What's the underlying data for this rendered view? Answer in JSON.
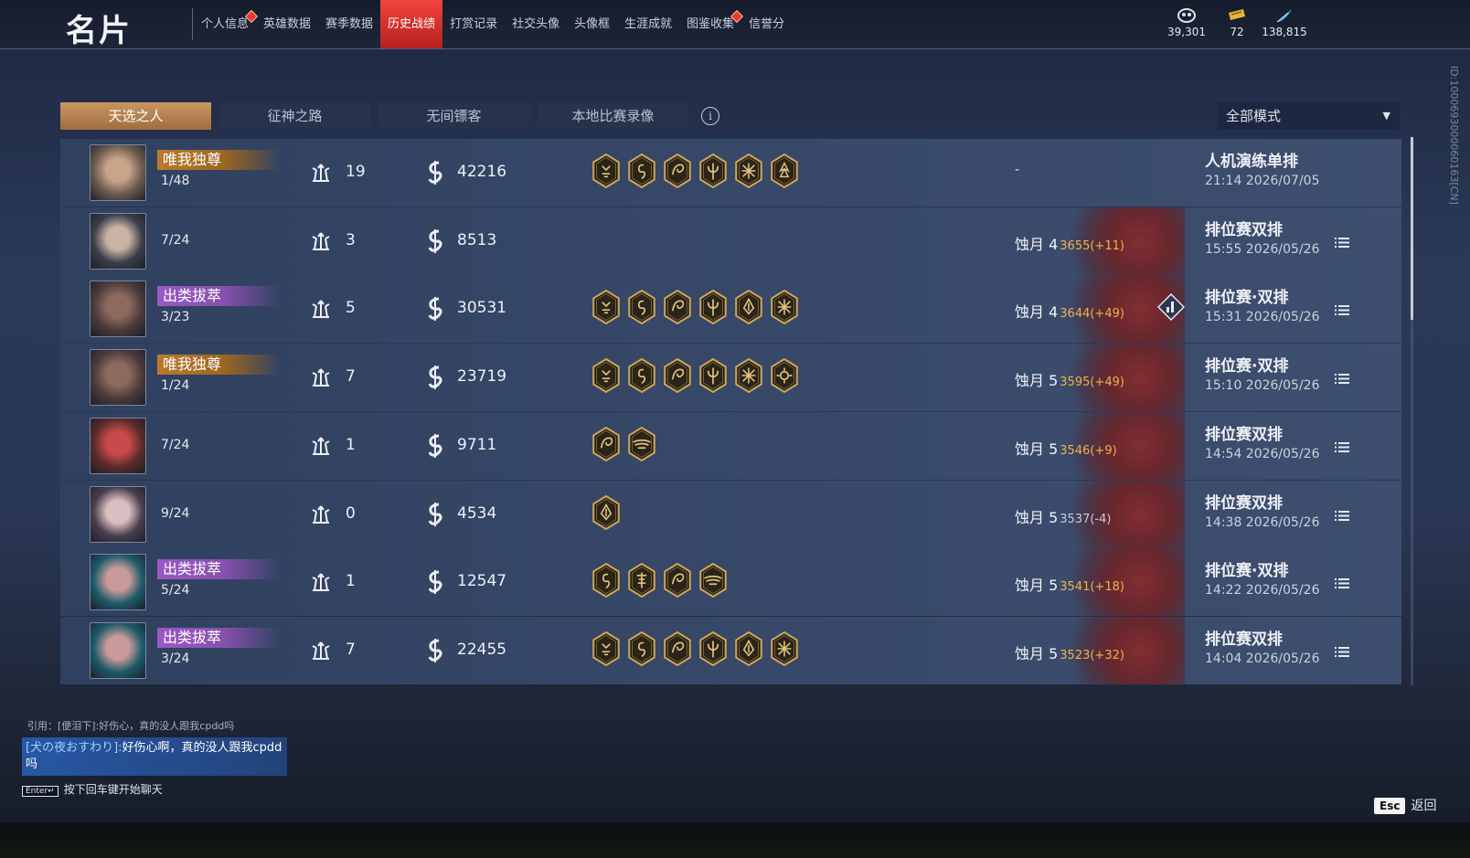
{
  "header": {
    "title": "名片",
    "tabs": [
      {
        "label": "个人信息",
        "dot": true,
        "active": false
      },
      {
        "label": "英雄数据",
        "dot": false,
        "active": false
      },
      {
        "label": "赛季数据",
        "dot": false,
        "active": false
      },
      {
        "label": "历史战绩",
        "dot": false,
        "active": true
      },
      {
        "label": "打赏记录",
        "dot": false,
        "active": false
      },
      {
        "label": "社交头像",
        "dot": false,
        "active": false
      },
      {
        "label": "头像框",
        "dot": false,
        "active": false
      },
      {
        "label": "生涯成就",
        "dot": false,
        "active": false
      },
      {
        "label": "图鉴收集",
        "dot": true,
        "active": false
      },
      {
        "label": "信誉分",
        "dot": false,
        "active": false
      }
    ],
    "currencies": [
      {
        "icon": "mask-coin-icon",
        "value": "39,301"
      },
      {
        "icon": "ticket-icon",
        "value": "72"
      },
      {
        "icon": "feather-icon",
        "value": "138,815"
      }
    ]
  },
  "side_id": "ID:1000693000060163[CN]",
  "mode_tabs": [
    "天选之人",
    "征神之路",
    "无间镖客",
    "本地比赛录像"
  ],
  "mode_filter": "全部模式",
  "rows": [
    {
      "title": "唯我独尊",
      "title_color": "gold",
      "rank": "1/48",
      "kills": "19",
      "score": "42216",
      "badges": [
        "demon-badge-icon",
        "swirl-badge-icon",
        "spiral-badge-icon",
        "trident-badge-icon",
        "star-badge-icon",
        "flame-badge-icon"
      ],
      "rank_name": "",
      "rank_points": "",
      "no_rank": "-",
      "match": "人机演练单排",
      "time": "21:14  2026/07/05",
      "menu": false,
      "stats": false
    },
    {
      "title": "",
      "title_color": "",
      "rank": "7/24",
      "kills": "3",
      "score": "8513",
      "badges": [],
      "rank_name": "蚀月 4",
      "rank_points": "3655(+11)",
      "change": "pos",
      "match": "排位赛双排",
      "time": "15:55  2026/05/26",
      "menu": true,
      "stats": false
    },
    {
      "title": "出类拔萃",
      "title_color": "purple",
      "rank": "3/23",
      "kills": "5",
      "score": "30531",
      "badges": [
        "demon-badge-icon",
        "swirl-badge-icon",
        "spiral-badge-icon",
        "trident-badge-icon",
        "lotus-badge-icon",
        "star-badge-icon"
      ],
      "rank_name": "蚀月 4",
      "rank_points": "3644(+49)",
      "change": "pos",
      "match": "排位赛·双排",
      "time": "15:31  2026/05/26",
      "menu": true,
      "stats": true
    },
    {
      "title": "唯我独尊",
      "title_color": "gold",
      "rank": "1/24",
      "kills": "7",
      "score": "23719",
      "badges": [
        "demon-badge-icon",
        "swirl-badge-icon",
        "spiral-badge-icon",
        "trident-badge-icon",
        "star-badge-icon",
        "gear-badge-icon"
      ],
      "rank_name": "蚀月 5",
      "rank_points": "3595(+49)",
      "change": "pos",
      "match": "排位赛·双排",
      "time": "15:10  2026/05/26",
      "menu": true,
      "stats": false
    },
    {
      "title": "",
      "title_color": "",
      "rank": "7/24",
      "kills": "1",
      "score": "9711",
      "badges": [
        "spiral-badge-icon",
        "wings-badge-icon"
      ],
      "rank_name": "蚀月 5",
      "rank_points": "3546(+9)",
      "change": "pos",
      "match": "排位赛双排",
      "time": "14:54  2026/05/26",
      "menu": true,
      "stats": false
    },
    {
      "title": "",
      "title_color": "",
      "rank": "9/24",
      "kills": "0",
      "score": "4534",
      "badges": [
        "lotus-badge-icon"
      ],
      "rank_name": "蚀月 5",
      "rank_points": "3537(-4)",
      "change": "neg",
      "match": "排位赛双排",
      "time": "14:38  2026/05/26",
      "menu": true,
      "stats": false
    },
    {
      "title": "出类拔萃",
      "title_color": "purple",
      "rank": "5/24",
      "kills": "1",
      "score": "12547",
      "badges": [
        "swirl-badge-icon",
        "pagoda-badge-icon",
        "spiral-badge-icon",
        "wings-badge-icon"
      ],
      "rank_name": "蚀月 5",
      "rank_points": "3541(+18)",
      "change": "pos",
      "match": "排位赛·双排",
      "time": "14:22  2026/05/26",
      "menu": true,
      "stats": false
    },
    {
      "title": "出类拔萃",
      "title_color": "purple",
      "rank": "3/24",
      "kills": "7",
      "score": "22455",
      "badges": [
        "demon-badge-icon",
        "swirl-badge-icon",
        "spiral-badge-icon",
        "trident-badge-icon",
        "lotus-badge-icon",
        "star-badge-icon"
      ],
      "rank_name": "蚀月 5",
      "rank_points": "3523(+32)",
      "change": "pos",
      "match": "排位赛双排",
      "time": "14:04  2026/05/26",
      "menu": true,
      "stats": false
    }
  ],
  "chat": {
    "quote": "引用：[便泪下]:好伤心，真的没人跟我cpdd吗",
    "sender": "[犬の夜おすわり]:",
    "message": "好伤心啊，真的没人跟我cpdd吗",
    "enter_key": "Enter↵",
    "hint": "按下回车键开始聊天"
  },
  "esc": {
    "key": "Esc",
    "label": "返回"
  },
  "colors": {
    "accent": "#e23c32",
    "gold_title": "#b97b2c",
    "purple_title": "#9b59c4",
    "points_up": "#f0b24b"
  }
}
